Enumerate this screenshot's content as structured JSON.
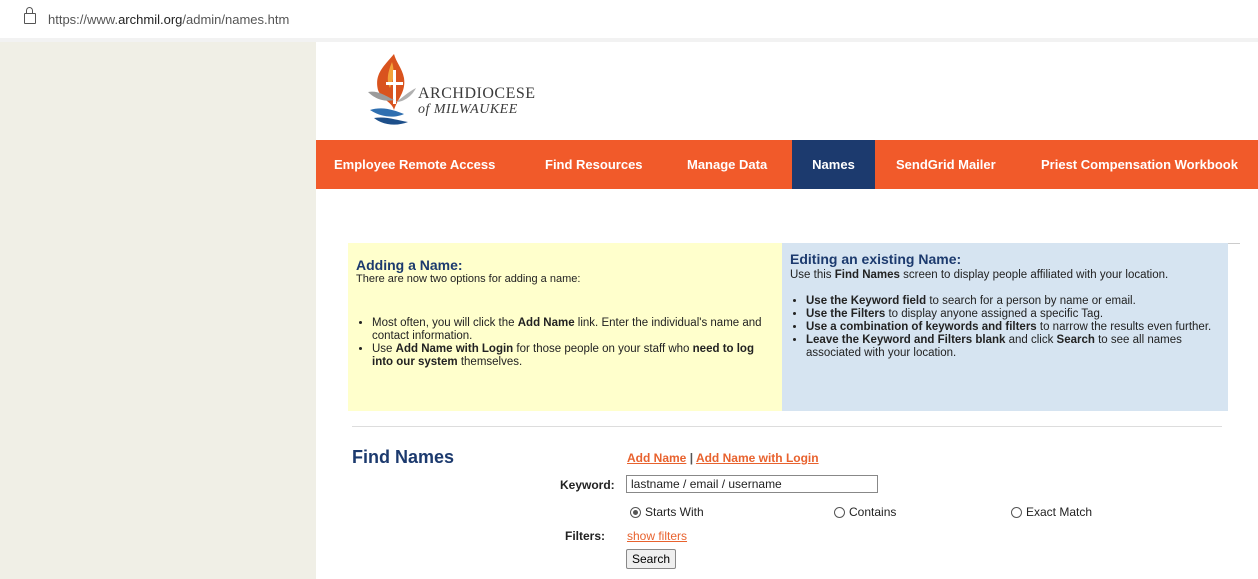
{
  "browser": {
    "url_prefix": "https://www.",
    "url_domain": "archmil.org",
    "url_path": "/admin/names.htm"
  },
  "logo": {
    "line1": "ARCHDIOCESE",
    "line2": "of MILWAUKEE"
  },
  "nav": [
    {
      "label": "Employee Remote Access",
      "active": false
    },
    {
      "label": "Find Resources",
      "active": false
    },
    {
      "label": "Manage Data",
      "active": false
    },
    {
      "label": "Names",
      "active": true
    },
    {
      "label": "SendGrid Mailer",
      "active": false
    },
    {
      "label": "Priest Compensation Workbook",
      "active": false
    }
  ],
  "adding": {
    "title": "Adding a Name:",
    "intro": "There are now two options for adding a name:",
    "b1_pre": "Most often, you will click the ",
    "b1_bold": "Add Name",
    "b1_post": " link. Enter the individual's name and contact information.",
    "b2_pre": "Use ",
    "b2_bold": "Add Name with Login",
    "b2_mid": " for those people on your staff who ",
    "b2_bold2": "need to log into our system",
    "b2_post": " themselves."
  },
  "editing": {
    "title": "Editing an existing Name:",
    "intro_pre": "Use this ",
    "intro_bold": "Find Names",
    "intro_post": " screen to display people affiliated with your location.",
    "b1_bold": "Use the Keyword field",
    "b1_post": " to search for a person by name or email.",
    "b2_bold": "Use the Filters",
    "b2_post": " to display anyone assigned a specific Tag.",
    "b3_bold": "Use a combination of keywords and filters",
    "b3_post": " to narrow the results even further.",
    "b4_bold": "Leave the Keyword and Filters blank",
    "b4_mid": " and click ",
    "b4_bold2": "Search",
    "b4_post": " to see all names associated with your location."
  },
  "find": {
    "title": "Find Names",
    "add_name": "Add Name",
    "separator": "|",
    "add_name_login": "Add Name with Login",
    "keyword_label": "Keyword:",
    "keyword_value": "lastname / email / username",
    "radios": [
      {
        "label": "Starts With",
        "checked": true
      },
      {
        "label": "Contains",
        "checked": false
      },
      {
        "label": "Exact Match",
        "checked": false
      }
    ],
    "filters_label": "Filters:",
    "show_filters": "show filters",
    "search_label": "Search"
  }
}
